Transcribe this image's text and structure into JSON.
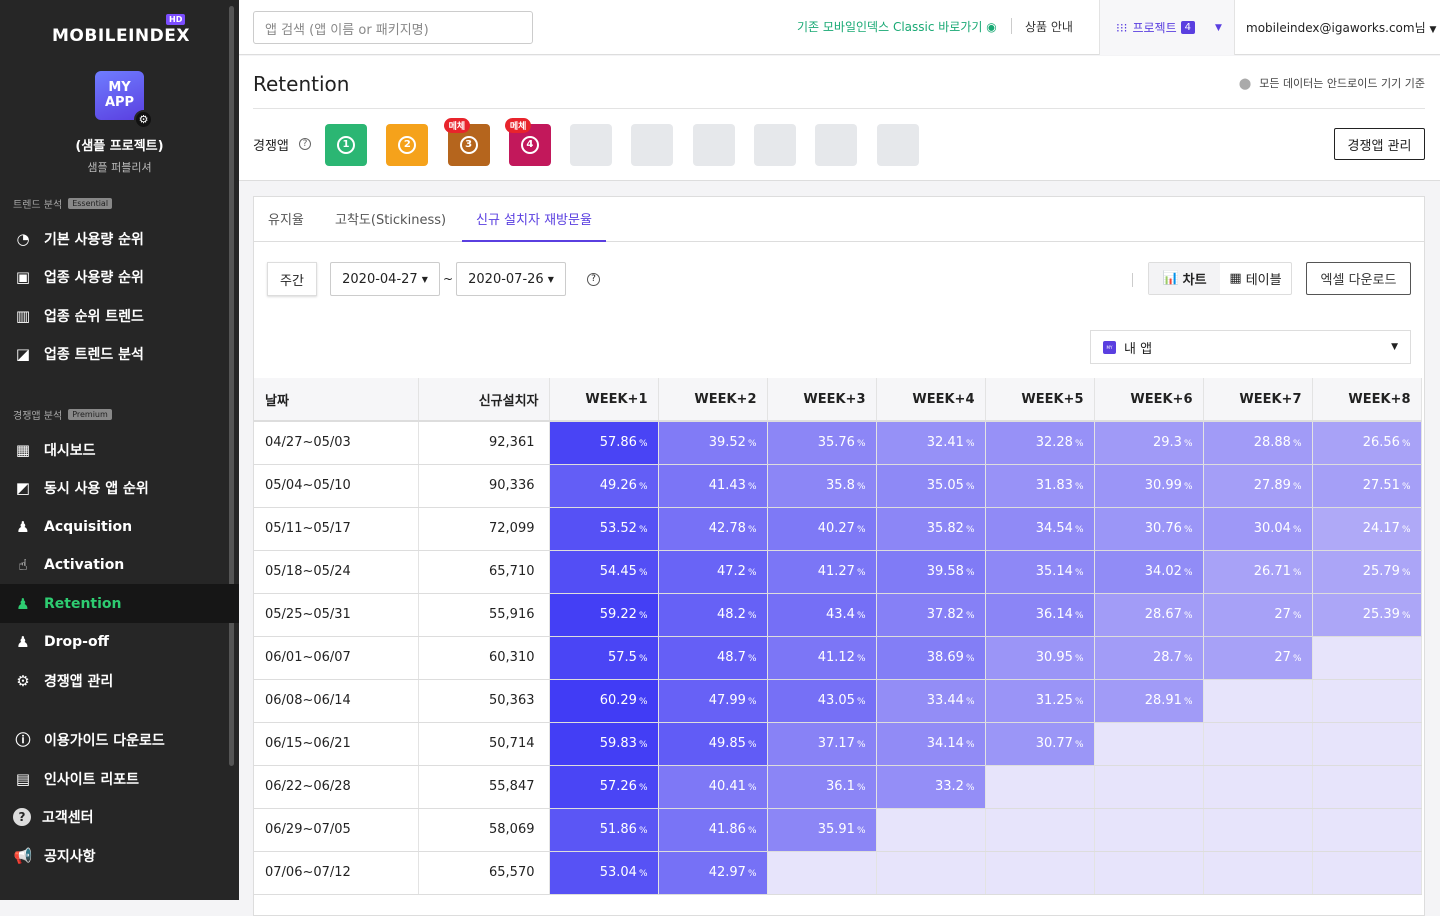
{
  "sidebar": {
    "logo": "MOBILEINDEX",
    "logo_badge": "HD",
    "app_badge": "MY APP",
    "project_name": "(샘플 프로젝트)",
    "project_sub": "샘플 퍼블리셔",
    "sections": {
      "trend": {
        "title": "트렌드 분석",
        "badge": "Essential"
      },
      "competitor": {
        "title": "경쟁앱 분석",
        "badge": "Premium"
      }
    },
    "items": [
      {
        "label": "기본 사용량 순위",
        "icon": "speedometer-icon"
      },
      {
        "label": "업종 사용량 순위",
        "icon": "store-icon"
      },
      {
        "label": "업종 순위 트렌드",
        "icon": "bar-chart-icon"
      },
      {
        "label": "업종 트렌드 분석",
        "icon": "trend-chart-icon"
      },
      {
        "label": "대시보드",
        "icon": "dashboard-icon"
      },
      {
        "label": "동시 사용 앱 순위",
        "icon": "images-icon"
      },
      {
        "label": "Acquisition",
        "icon": "user-plus-icon"
      },
      {
        "label": "Activation",
        "icon": "hand-pointer-icon"
      },
      {
        "label": "Retention",
        "icon": "user-retention-icon"
      },
      {
        "label": "Drop-off",
        "icon": "user-minus-icon"
      },
      {
        "label": "경쟁앱 관리",
        "icon": "gear-icon"
      },
      {
        "label": "이용가이드 다운로드",
        "icon": "info-icon"
      },
      {
        "label": "인사이트 리포트",
        "icon": "document-icon"
      },
      {
        "label": "고객센터",
        "icon": "help-icon"
      },
      {
        "label": "공지사항",
        "icon": "megaphone-icon"
      }
    ],
    "active_item": "Retention"
  },
  "topbar": {
    "search_placeholder": "앱 검색 (앱 이름 or 패키지명)",
    "classic_link": "기존 모바일인덱스 Classic 바로가기",
    "product_info": "상품 안내",
    "project_label": "프로젝트",
    "project_count": "4",
    "user": "mobileindex@igaworks.com님"
  },
  "header": {
    "title": "Retention",
    "note": "모든 데이터는 안드로이드 기기 기준",
    "competitor_label": "경쟁앱",
    "competitors": [
      {
        "num": "1",
        "color": "#2bb673",
        "tag": ""
      },
      {
        "num": "2",
        "color": "#f5a21b",
        "tag": ""
      },
      {
        "num": "3",
        "color": "#b5651d",
        "tag": "메체"
      },
      {
        "num": "4",
        "color": "#c2185b",
        "tag": "메체"
      }
    ],
    "empty_slots": 6,
    "manage_button": "경쟁앱 관리"
  },
  "tabs": [
    "유지율",
    "고착도(Stickiness)",
    "신규 설치자 재방문율"
  ],
  "active_tab": "신규 설치자 재방문율",
  "controls": {
    "period": "주간",
    "start_date": "2020-04-27",
    "end_date": "2020-07-26",
    "tilde": "~",
    "chart_label": "차트",
    "table_label": "테이블",
    "excel_label": "엑셀 다운로드",
    "app_select": "내 앱"
  },
  "table": {
    "headers": [
      "날짜",
      "신규설치자",
      "WEEK+1",
      "WEEK+2",
      "WEEK+3",
      "WEEK+4",
      "WEEK+5",
      "WEEK+6",
      "WEEK+7",
      "WEEK+8"
    ],
    "unit": "%",
    "rows": [
      {
        "date": "04/27~05/03",
        "installs": "92,361",
        "weeks": [
          "57.86",
          "39.52",
          "35.76",
          "32.41",
          "32.28",
          "29.3",
          "28.88",
          "26.56"
        ]
      },
      {
        "date": "05/04~05/10",
        "installs": "90,336",
        "weeks": [
          "49.26",
          "41.43",
          "35.8",
          "35.05",
          "31.83",
          "30.99",
          "27.89",
          "27.51"
        ]
      },
      {
        "date": "05/11~05/17",
        "installs": "72,099",
        "weeks": [
          "53.52",
          "42.78",
          "40.27",
          "35.82",
          "34.54",
          "30.76",
          "30.04",
          "24.17"
        ]
      },
      {
        "date": "05/18~05/24",
        "installs": "65,710",
        "weeks": [
          "54.45",
          "47.2",
          "41.27",
          "39.58",
          "35.14",
          "34.02",
          "26.71",
          "25.79"
        ]
      },
      {
        "date": "05/25~05/31",
        "installs": "55,916",
        "weeks": [
          "59.22",
          "48.2",
          "43.4",
          "37.82",
          "36.14",
          "28.67",
          "27",
          "25.39"
        ]
      },
      {
        "date": "06/01~06/07",
        "installs": "60,310",
        "weeks": [
          "57.5",
          "48.7",
          "41.12",
          "38.69",
          "30.95",
          "28.7",
          "27",
          ""
        ]
      },
      {
        "date": "06/08~06/14",
        "installs": "50,363",
        "weeks": [
          "60.29",
          "47.99",
          "43.05",
          "33.44",
          "31.25",
          "28.91",
          "",
          ""
        ]
      },
      {
        "date": "06/15~06/21",
        "installs": "50,714",
        "weeks": [
          "59.83",
          "49.85",
          "37.17",
          "34.14",
          "30.77",
          "",
          "",
          ""
        ]
      },
      {
        "date": "06/22~06/28",
        "installs": "55,847",
        "weeks": [
          "57.26",
          "40.41",
          "36.1",
          "33.2",
          "",
          "",
          "",
          ""
        ]
      },
      {
        "date": "06/29~07/05",
        "installs": "58,069",
        "weeks": [
          "51.86",
          "41.86",
          "35.91",
          "",
          "",
          "",
          "",
          ""
        ]
      },
      {
        "date": "07/06~07/12",
        "installs": "65,570",
        "weeks": [
          "53.04",
          "42.97",
          "",
          "",
          "",
          "",
          "",
          ""
        ]
      }
    ]
  },
  "colors": {
    "accent": "#5a3fe0",
    "classic_green": "#19a974",
    "active_nav": "#2ecc71",
    "cell_strong": "#3f3af5",
    "cell_weak": "#b0aaf7",
    "cell_empty": "#e7e4fb"
  }
}
